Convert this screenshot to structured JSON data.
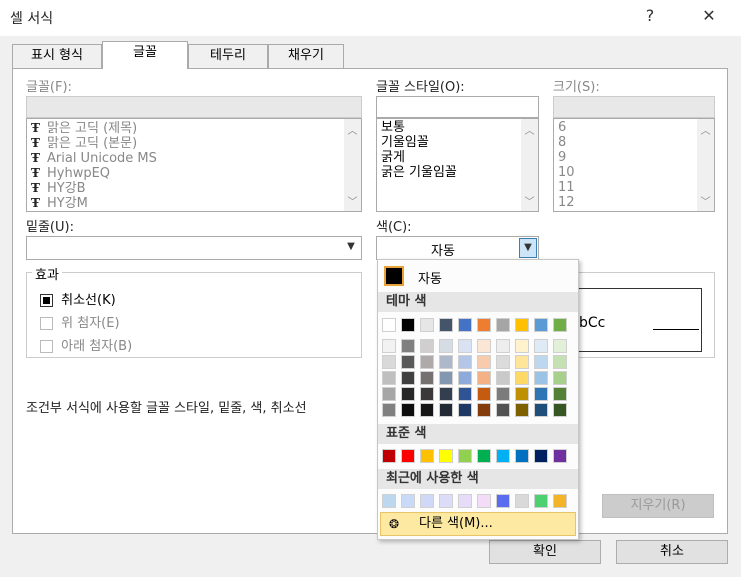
{
  "window": {
    "title": "셀 서식",
    "help": "?",
    "close": "✕"
  },
  "tabs": [
    "표시 형식",
    "글꼴",
    "테두리",
    "채우기"
  ],
  "font": {
    "label": "글꼴(F):",
    "items": [
      "맑은 고딕 (제목)",
      "맑은 고딕 (본문)",
      "Arial Unicode MS",
      "HyhwpEQ",
      "HY강B",
      "HY강M"
    ]
  },
  "style": {
    "label": "글꼴 스타일(O):",
    "items": [
      "보통",
      "기울임꼴",
      "굵게",
      "굵은 기울임꼴"
    ]
  },
  "size": {
    "label": "크기(S):",
    "items": [
      "6",
      "8",
      "9",
      "10",
      "11",
      "12"
    ]
  },
  "underline": {
    "label": "밑줄(U):"
  },
  "color": {
    "label": "색(C):",
    "value": "자동"
  },
  "effects": {
    "title": "효과",
    "strike": "취소선(K)",
    "superscript": "위 첨자(E)",
    "subscript": "아래 첨자(B)"
  },
  "preview": {
    "text": "bCc"
  },
  "info": "조건부 서식에 사용할 글꼴 스타일, 밑줄, 색, 취소선",
  "buttons": {
    "clear": "지우기(R)",
    "ok": "확인",
    "cancel": "취소"
  },
  "palette": {
    "auto": "자동",
    "theme_label": "테마 색",
    "standard_label": "표준 색",
    "recent_label": "최근에 사용한 색",
    "more": "다른 색(M)...",
    "theme_top": [
      "#ffffff",
      "#000000",
      "#e7e6e6",
      "#44546a",
      "#4472c4",
      "#ed7d31",
      "#a5a5a5",
      "#ffc000",
      "#5b9bd5",
      "#70ad47"
    ],
    "theme_columns": [
      [
        "#f2f2f2",
        "#d9d9d9",
        "#bfbfbf",
        "#a6a6a6",
        "#808080"
      ],
      [
        "#808080",
        "#595959",
        "#404040",
        "#262626",
        "#0d0d0d"
      ],
      [
        "#d0cece",
        "#aeaaaa",
        "#757171",
        "#3a3838",
        "#171616"
      ],
      [
        "#d6dce4",
        "#adb9ca",
        "#8497b0",
        "#333f4f",
        "#222a35"
      ],
      [
        "#d9e2f3",
        "#b4c6e7",
        "#8eaadb",
        "#2f5496",
        "#1f3864"
      ],
      [
        "#fbe5d5",
        "#f7cbac",
        "#f4b183",
        "#c55a11",
        "#833c0b"
      ],
      [
        "#ededed",
        "#dbdbdb",
        "#c9c9c9",
        "#7b7b7b",
        "#525252"
      ],
      [
        "#fff2cc",
        "#fee599",
        "#ffd966",
        "#bf9000",
        "#7f6000"
      ],
      [
        "#deebf6",
        "#bdd7ee",
        "#9cc3e5",
        "#2e75b5",
        "#1e4e79"
      ],
      [
        "#e2efd9",
        "#c5e0b3",
        "#a8d08d",
        "#538135",
        "#375623"
      ]
    ],
    "standard": [
      "#c00000",
      "#ff0000",
      "#ffc000",
      "#ffff00",
      "#92d050",
      "#00b050",
      "#00b0f0",
      "#0070c0",
      "#002060",
      "#7030a0"
    ],
    "recent": [
      "#bdd7ee",
      "#c9daf8",
      "#d0d8f8",
      "#dcdcf8",
      "#e6dcf8",
      "#f2dcf8",
      "#5a6cf0",
      "#d9d9d9",
      "#4cd070",
      "#f4b42a"
    ]
  }
}
